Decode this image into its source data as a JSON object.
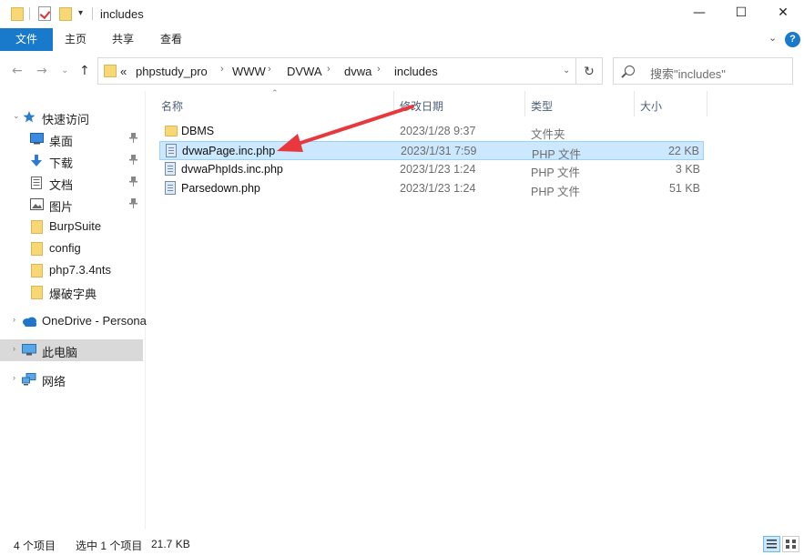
{
  "window": {
    "title": "includes",
    "minimize_icon": "—",
    "maximize_icon": "☐",
    "close_icon": "✕"
  },
  "ribbon": {
    "tabs": [
      "文件",
      "主页",
      "共享",
      "查看"
    ],
    "expand_icon": "⌄",
    "help_icon": "?"
  },
  "navigation": {
    "back_icon": "←",
    "forward_icon": "→",
    "recent_icon": "⌄",
    "up_icon": "↑",
    "overflow": "«",
    "breadcrumbs": [
      "phpstudy_pro",
      "WWW",
      "DVWA",
      "dvwa",
      "includes"
    ],
    "refresh_icon": "↻"
  },
  "search": {
    "placeholder": "搜索\"includes\""
  },
  "sidebar": {
    "quick_access": "快速访问",
    "items": [
      {
        "label": "桌面",
        "pinned": true
      },
      {
        "label": "下载",
        "pinned": true
      },
      {
        "label": "文档",
        "pinned": true
      },
      {
        "label": "图片",
        "pinned": true
      },
      {
        "label": "BurpSuite",
        "pinned": false
      },
      {
        "label": "config",
        "pinned": false
      },
      {
        "label": "php7.3.4nts",
        "pinned": false
      },
      {
        "label": "爆破字典",
        "pinned": false
      }
    ],
    "onedrive": "OneDrive - Persona",
    "this_pc": "此电脑",
    "network": "网络",
    "pin_icon": "📌"
  },
  "columns": {
    "name": "名称",
    "date": "修改日期",
    "type": "类型",
    "size": "大小"
  },
  "files": [
    {
      "name": "DBMS",
      "date": "2023/1/28 9:37",
      "type": "文件夹",
      "size": "",
      "kind": "folder",
      "selected": false
    },
    {
      "name": "dvwaPage.inc.php",
      "date": "2023/1/31 7:59",
      "type": "PHP 文件",
      "size": "22 KB",
      "kind": "file",
      "selected": true
    },
    {
      "name": "dvwaPhpIds.inc.php",
      "date": "2023/1/23 1:24",
      "type": "PHP 文件",
      "size": "3 KB",
      "kind": "file",
      "selected": false
    },
    {
      "name": "Parsedown.php",
      "date": "2023/1/23 1:24",
      "type": "PHP 文件",
      "size": "51 KB",
      "kind": "file",
      "selected": false
    }
  ],
  "status": {
    "item_count": "4 个项目",
    "selection": "选中 1 个项目",
    "selection_size": "21.7 KB"
  },
  "colors": {
    "accent": "#1979ca",
    "selection_bg": "#cce8ff",
    "annotation_arrow": "#e8383d"
  }
}
